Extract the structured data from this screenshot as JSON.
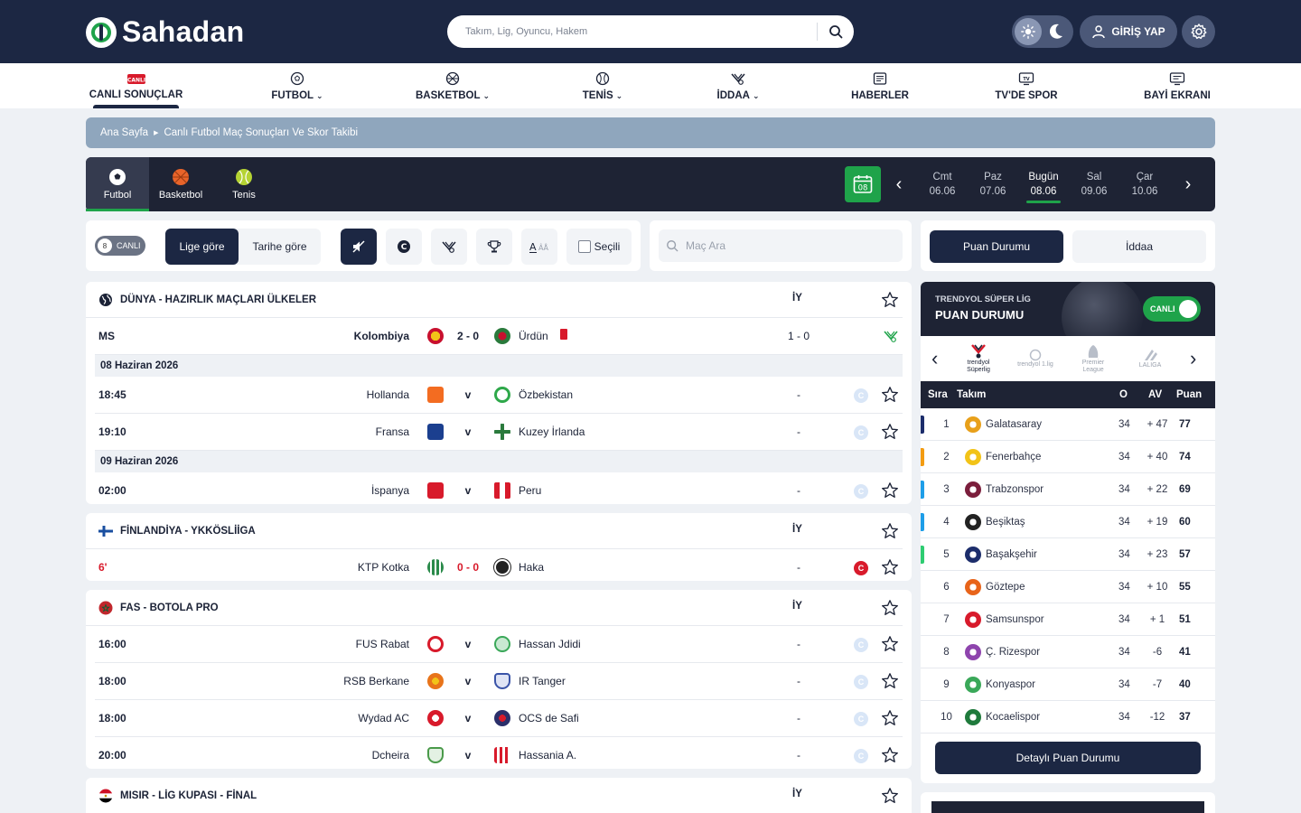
{
  "header": {
    "logo_text": "Sahadan",
    "search_placeholder": "Takım, Lig, Oyuncu, Hakem",
    "login_label": "GİRİŞ YAP"
  },
  "nav": [
    {
      "label": "CANLI SONUÇLAR",
      "badge": "CANLI",
      "icon": "live-icon",
      "chevron": false
    },
    {
      "label": "FUTBOL",
      "icon": "football-icon",
      "chevron": true
    },
    {
      "label": "BASKETBOL",
      "icon": "basketball-icon",
      "chevron": true
    },
    {
      "label": "TENİS",
      "icon": "tennis-icon",
      "chevron": true
    },
    {
      "label": "İDDAA",
      "icon": "iddaa-icon",
      "chevron": true
    },
    {
      "label": "HABERLER",
      "icon": "news-icon",
      "chevron": false
    },
    {
      "label": "TV'DE SPOR",
      "icon": "tv-icon",
      "chevron": false
    },
    {
      "label": "BAYİ EKRANI",
      "icon": "dealer-screen-icon",
      "chevron": false
    }
  ],
  "breadcrumb": {
    "home": "Ana Sayfa",
    "current": "Canlı Futbol Maç Sonuçları Ve Skor Takibi"
  },
  "sports": [
    {
      "label": "Futbol",
      "active": true,
      "color": "#ffffff"
    },
    {
      "label": "Basketbol",
      "active": false,
      "color": "#e8642a"
    },
    {
      "label": "Tenis",
      "active": false,
      "color": "#b5d333"
    }
  ],
  "calendar": {
    "day": "08",
    "dates": [
      {
        "day": "Cmt",
        "date": "06.06",
        "active": false
      },
      {
        "day": "Paz",
        "date": "07.06",
        "active": false
      },
      {
        "day": "Bugün",
        "date": "08.06",
        "active": true
      },
      {
        "day": "Sal",
        "date": "09.06",
        "active": false
      },
      {
        "day": "Çar",
        "date": "10.06",
        "active": false
      }
    ]
  },
  "filters": {
    "live_count": "8",
    "live_label": "CANLI",
    "by_league": "Lige göre",
    "by_date": "Tarihe göre",
    "selected": "Seçili",
    "search_placeholder": "Maç Ara"
  },
  "right_tabs": {
    "standings": "Puan Durumu",
    "betting": "İddaa"
  },
  "leagues": [
    {
      "title": "DÜNYA - HAZIRLIK MAÇLARI ÜLKELER",
      "flag": "globe",
      "iy": "İY",
      "items": [
        {
          "type": "match",
          "time": "MS",
          "home": "Kolombiya",
          "score": "2 - 0",
          "away": "Ürdün",
          "ht": "1 - 0",
          "status": "finished",
          "home_color": "#f2c318",
          "away_color": "#c8102e",
          "redcard": true
        },
        {
          "type": "date",
          "label": "08 Haziran 2026"
        },
        {
          "type": "match",
          "time": "18:45",
          "home": "Hollanda",
          "score": "v",
          "away": "Özbekistan",
          "ht": "-",
          "status": "pending",
          "home_color": "#f36c21",
          "away_color": "#2ea84a"
        },
        {
          "type": "match",
          "time": "19:10",
          "home": "Fransa",
          "score": "v",
          "away": "Kuzey İrlanda",
          "ht": "-",
          "status": "pending",
          "home_color": "#1b3f8f",
          "away_color": "#2a7a3c"
        },
        {
          "type": "date",
          "label": "09 Haziran 2026"
        },
        {
          "type": "match",
          "time": "02:00",
          "home": "İspanya",
          "score": "v",
          "away": "Peru",
          "ht": "-",
          "status": "pending",
          "home_color": "#d81a2b",
          "away_color": "#d81a2b"
        }
      ]
    },
    {
      "title": "FİNLANDİYA - YKKÖSLİİGA",
      "flag": "finland",
      "iy": "İY",
      "items": [
        {
          "type": "match",
          "time": "6'",
          "home": "KTP Kotka",
          "score": "0 - 0",
          "away": "Haka",
          "ht": "-",
          "status": "live",
          "home_color": "#2a8a4a",
          "away_color": "#222222"
        }
      ]
    },
    {
      "title": "FAS - BOTOLA PRO",
      "flag": "morocco",
      "iy": "İY",
      "items": [
        {
          "type": "match",
          "time": "16:00",
          "home": "FUS Rabat",
          "score": "v",
          "away": "Hassan Jdidi",
          "ht": "-",
          "status": "pending",
          "home_color": "#d81a2b",
          "away_color": "#3aa859"
        },
        {
          "type": "match",
          "time": "18:00",
          "home": "RSB Berkane",
          "score": "v",
          "away": "IR Tanger",
          "ht": "-",
          "status": "pending",
          "home_color": "#e8741a",
          "away_color": "#3a54a8"
        },
        {
          "type": "match",
          "time": "18:00",
          "home": "Wydad AC",
          "score": "v",
          "away": "OCS de Safi",
          "ht": "-",
          "status": "pending",
          "home_color": "#d81a2b",
          "away_color": "#2b2f6a"
        },
        {
          "type": "match",
          "time": "20:00",
          "home": "Dcheira",
          "score": "v",
          "away": "Hassania A.",
          "ht": "-",
          "status": "pending",
          "home_color": "#4a9a4a",
          "away_color": "#d81a2b"
        }
      ]
    },
    {
      "title": "MISIR - LİG KUPASI - FİNAL",
      "flag": "egypt",
      "iy": "İY",
      "items": []
    }
  ],
  "standings": {
    "banner_sub": "TRENDYOL SÜPER LİG",
    "banner_title": "PUAN DURUMU",
    "live_label": "CANLI",
    "carousel": [
      {
        "label": "trendyol Süperlig",
        "active": true
      },
      {
        "label": "trendyol 1.lig",
        "active": false
      },
      {
        "label": "Premier League",
        "active": false
      },
      {
        "label": "LALIGA",
        "active": false
      }
    ],
    "columns": {
      "rank": "Sıra",
      "team": "Takım",
      "played": "O",
      "avg": "AV",
      "points": "Puan"
    },
    "rows": [
      {
        "rank": "1",
        "team": "Galatasaray",
        "played": "34",
        "avg": "+ 47",
        "points": "77",
        "bar": "#1c2d6b",
        "logo": "#e8a01a"
      },
      {
        "rank": "2",
        "team": "Fenerbahçe",
        "played": "34",
        "avg": "+ 40",
        "points": "74",
        "bar": "#f39c12",
        "logo": "#f2c318"
      },
      {
        "rank": "3",
        "team": "Trabzonspor",
        "played": "34",
        "avg": "+ 22",
        "points": "69",
        "bar": "#1e9ee8",
        "logo": "#7b1e3c"
      },
      {
        "rank": "4",
        "team": "Beşiktaş",
        "played": "34",
        "avg": "+ 19",
        "points": "60",
        "bar": "#1e9ee8",
        "logo": "#222222"
      },
      {
        "rank": "5",
        "team": "Başakşehir",
        "played": "34",
        "avg": "+ 23",
        "points": "57",
        "bar": "#2ecc71",
        "logo": "#1c2d6b"
      },
      {
        "rank": "6",
        "team": "Göztepe",
        "played": "34",
        "avg": "+ 10",
        "points": "55",
        "bar": "",
        "logo": "#e8641a"
      },
      {
        "rank": "7",
        "team": "Samsunspor",
        "played": "34",
        "avg": "+ 1",
        "points": "51",
        "bar": "",
        "logo": "#d81a2b"
      },
      {
        "rank": "8",
        "team": "Ç. Rizespor",
        "played": "34",
        "avg": "-6",
        "points": "41",
        "bar": "",
        "logo": "#8e44ad"
      },
      {
        "rank": "9",
        "team": "Konyaspor",
        "played": "34",
        "avg": "-7",
        "points": "40",
        "bar": "",
        "logo": "#3aa859"
      },
      {
        "rank": "10",
        "team": "Kocaelispor",
        "played": "34",
        "avg": "-12",
        "points": "37",
        "bar": "",
        "logo": "#1f7a3c"
      }
    ],
    "detail_button": "Detaylı Puan Durumu"
  }
}
